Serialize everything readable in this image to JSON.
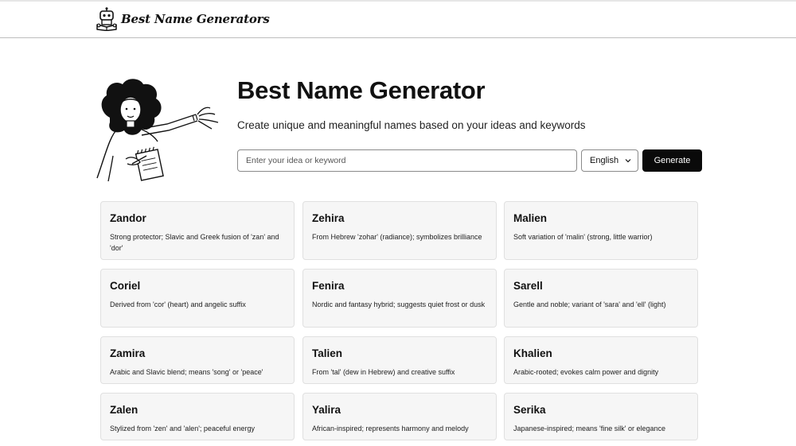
{
  "header": {
    "brand_name": "Best Name Generators",
    "logo_icon": "robot-reading-icon"
  },
  "hero": {
    "title": "Best Name Generator",
    "subtitle": "Create unique and meaningful names based on your ideas and keywords",
    "illustration": "woman-waving-with-notepad-illustration"
  },
  "search": {
    "placeholder": "Enter your idea or keyword",
    "value": ""
  },
  "language": {
    "selected": "English",
    "icon": "chevron-down-icon"
  },
  "generate_label": "Generate",
  "colors": {
    "accent": "#0a0a0a",
    "card_bg": "#f6f6f6",
    "card_border": "#e0e0e0"
  },
  "names": [
    {
      "name": "Zandor",
      "desc": "Strong protector; Slavic and Greek fusion of 'zan' and 'dor'"
    },
    {
      "name": "Zehira",
      "desc": "From Hebrew 'zohar' (radiance); symbolizes brilliance"
    },
    {
      "name": "Malien",
      "desc": "Soft variation of 'malin' (strong, little warrior)"
    },
    {
      "name": "Coriel",
      "desc": "Derived from 'cor' (heart) and angelic suffix"
    },
    {
      "name": "Fenira",
      "desc": "Nordic and fantasy hybrid; suggests quiet frost or dusk"
    },
    {
      "name": "Sarell",
      "desc": "Gentle and noble; variant of 'sara' and 'ell' (light)"
    },
    {
      "name": "Zamira",
      "desc": "Arabic and Slavic blend; means 'song' or 'peace'"
    },
    {
      "name": "Talien",
      "desc": "From 'tal' (dew in Hebrew) and creative suffix"
    },
    {
      "name": "Khalien",
      "desc": "Arabic-rooted; evokes calm power and dignity"
    },
    {
      "name": "Zalen",
      "desc": "Stylized from 'zen' and 'alen'; peaceful energy"
    },
    {
      "name": "Yalira",
      "desc": "African-inspired; represents harmony and melody"
    },
    {
      "name": "Serika",
      "desc": "Japanese-inspired; means 'fine silk' or elegance"
    }
  ]
}
